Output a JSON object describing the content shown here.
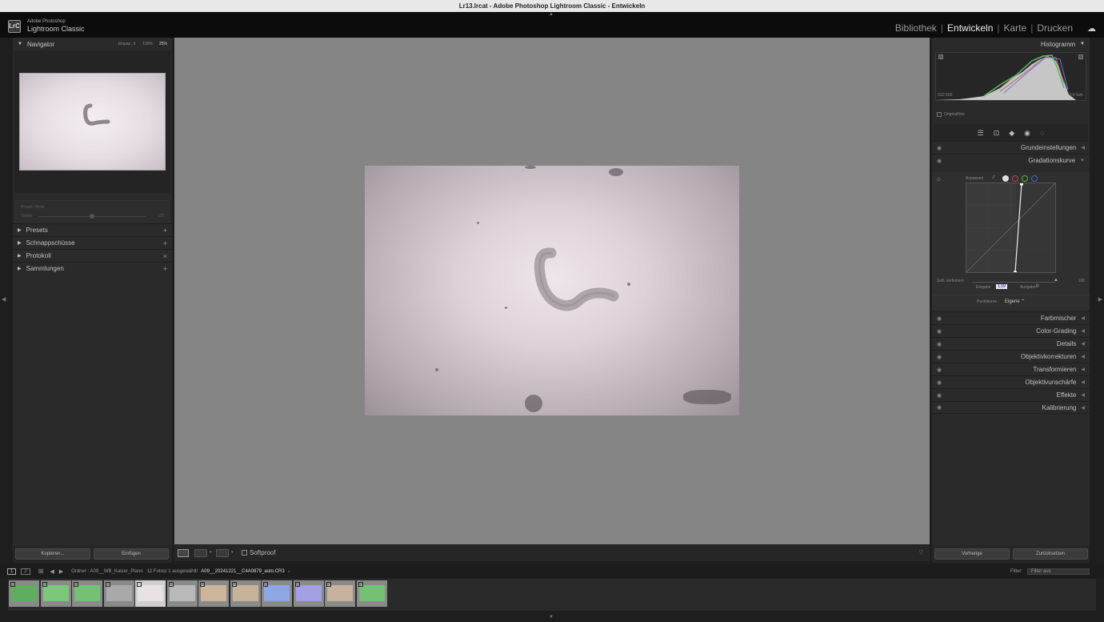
{
  "window": {
    "title": "Lr13.lrcat - Adobe Photoshop Lightroom Classic - Entwickeln"
  },
  "app": {
    "logo": "LrC",
    "line1": "Adobe Photoshop",
    "line2": "Lightroom Classic"
  },
  "modules": [
    "Bibliothek",
    "Entwickeln",
    "Karte",
    "Drucken"
  ],
  "active_module": "Entwickeln",
  "left_panel": {
    "navigator": {
      "title": "Navigator",
      "zoom": [
        "Einpas. ⇕",
        "100%",
        "25%"
      ],
      "selected_zoom": "25%"
    },
    "snapshot_hint": {
      "label": "Preset: Ohne",
      "slider": "Stärke",
      "value": "100"
    },
    "sections": [
      {
        "label": "Presets",
        "action": "+"
      },
      {
        "label": "Schnappschüsse",
        "action": "+"
      },
      {
        "label": "Protokoll",
        "action": "×"
      },
      {
        "label": "Sammlungen",
        "action": "+"
      }
    ],
    "copy_label": "Kopieren...",
    "paste_label": "Einfügen"
  },
  "toolbar": {
    "softproof_label": "Softproof"
  },
  "right_panel": {
    "histogram": {
      "title": "Histogramm",
      "iso": "ISO 500",
      "shutter": "0,4 Sek.",
      "original_label": "Originalfoto"
    },
    "sections_top": [
      "Grundeinstellungen",
      "Gradationskurve"
    ],
    "curve": {
      "adjust_label": "Anpassen",
      "soften_label": "Satt. verfeinern",
      "slider_value": "100",
      "input_label": "Eingabe",
      "input_value": "139",
      "output_label": "Ausgabe",
      "output_value": "0",
      "pointcurve_label": "Punktkurve :",
      "pointcurve_value": "Eigene ⌃"
    },
    "sections": [
      "Farbmischer",
      "Color-Grading",
      "Details",
      "Objektivkorrekturen",
      "Transformieren",
      "Objektivunschärfe",
      "Effekte",
      "Kalibrierung"
    ],
    "prev_label": "Vorherige",
    "reset_label": "Zurücksetzen"
  },
  "filmstrip": {
    "page1": "1",
    "page2": "2",
    "path_prefix": "Ordner : A09__WB_Kaiser_Plano",
    "count": "12 Fotos/ 1 ausgewählt/",
    "file": "A09__20241221__C4A0879_auto.CR3",
    "filter_label": "Filter:",
    "filter_value": "Filter aus",
    "thumb_colors": [
      "#5fae5f",
      "#7cc77c",
      "#74c074",
      "#a9a9a9",
      "#e8e2e6",
      "#b9b9b9",
      "#cdb59b",
      "#c7b29a",
      "#8fa8e4",
      "#a4a0e4",
      "#c7b29f",
      "#74c074"
    ]
  }
}
